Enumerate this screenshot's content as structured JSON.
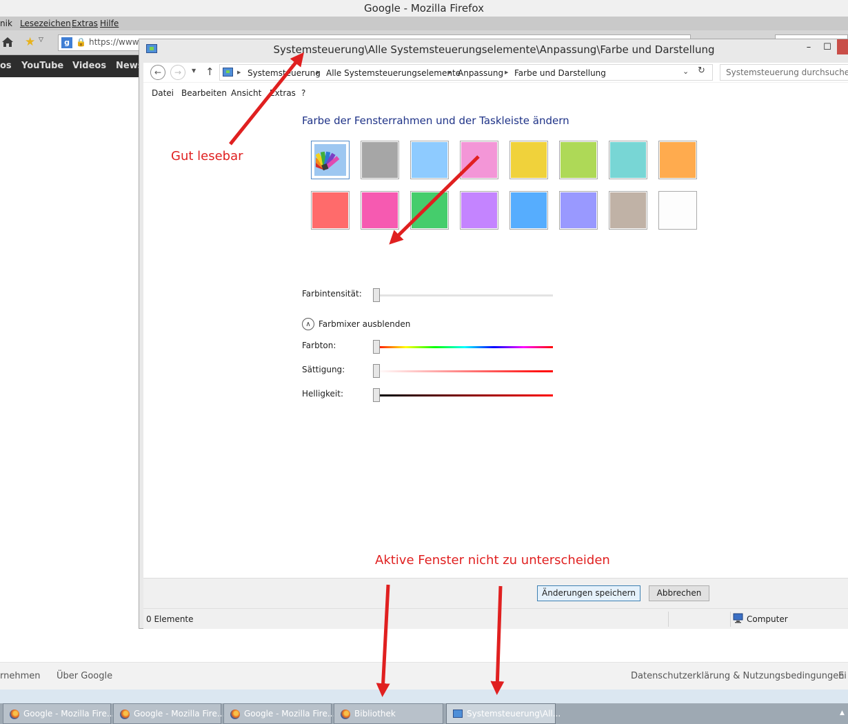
{
  "firefox": {
    "title": "Google - Mozilla Firefox",
    "menu": [
      "nik",
      "Lesezeichen",
      "Extras",
      "Hilfe"
    ],
    "url": "https://www.g",
    "google_bar": [
      "os",
      "YouTube",
      "Videos",
      "News"
    ],
    "footer": {
      "left": "rnehmen",
      "about": "Über Google",
      "privacy": "Datenschutzerklärung & Nutzungsbedingungen",
      "right": "Ei"
    }
  },
  "window": {
    "title": "Systemsteuerung\\Alle Systemsteuerungselemente\\Anpassung\\Farbe und Darstellung",
    "minimize": "–",
    "maximize": "☐",
    "breadcrumbs": [
      "Systemsteuerung",
      "Alle Systemsteuerungselemente",
      "Anpassung",
      "Farbe und Darstellung"
    ],
    "search_placeholder": "Systemsteuerung durchsuchen",
    "menu": [
      "Datei",
      "Bearbeiten",
      "Ansicht",
      "Extras",
      "?"
    ],
    "heading": "Farbe der Fensterrahmen und der Taskleiste ändern",
    "swatch_colors": [
      [
        "auto",
        "#a6a6a6",
        "#8ecbff",
        "#f396d7",
        "#f0d23b",
        "#aed957",
        "#78d6d5",
        "#ffab4e"
      ],
      [
        "#ff6b6b",
        "#f65ab1",
        "#45cd6c",
        "#c484ff",
        "#56adfe",
        "#9999ff",
        "#c0b2a6",
        "#fdfdfd"
      ]
    ],
    "intensity_label": "Farbintensität:",
    "mixer_toggle": "Farbmixer ausblenden",
    "hue_label": "Farbton:",
    "saturation_label": "Sättigung:",
    "brightness_label": "Helligkeit:",
    "save_button": "Änderungen speichern",
    "cancel_button": "Abbrechen",
    "status_count": "0 Elemente",
    "status_computer": "Computer"
  },
  "taskbar": [
    {
      "label": "Google - Mozilla Fire...",
      "icon": "firefox-icon"
    },
    {
      "label": "Google - Mozilla Fire...",
      "icon": "firefox-icon"
    },
    {
      "label": "Google - Mozilla Fire...",
      "icon": "firefox-icon"
    },
    {
      "label": "Bibliothek",
      "icon": "firefox-icon"
    },
    {
      "label": "Systemsteuerung\\All...",
      "icon": "control-panel-icon"
    }
  ],
  "annotations": {
    "readable": "Gut lesebar",
    "not_distinguishable": "Aktive Fenster nicht zu unterscheiden",
    "color": "#e02020"
  }
}
